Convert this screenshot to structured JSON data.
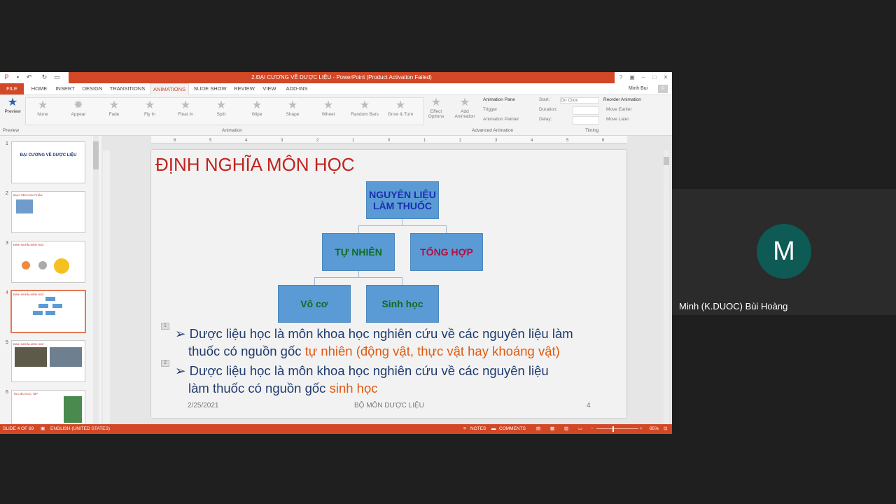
{
  "window": {
    "title": "2.ĐẠI CƯƠNG VỀ DƯỢC LIỆU - PowerPoint (Product Activation Failed)",
    "user": "Minh Bui",
    "accent": "#d24726"
  },
  "tabs": [
    "FILE",
    "HOME",
    "INSERT",
    "DESIGN",
    "TRANSITIONS",
    "ANIMATIONS",
    "SLIDE SHOW",
    "REVIEW",
    "VIEW",
    "ADD-INS"
  ],
  "ribbon": {
    "preview_label": "Preview",
    "preview_group": "Preview",
    "animations": [
      "None",
      "Appear",
      "Fade",
      "Fly In",
      "Float In",
      "Split",
      "Wipe",
      "Shape",
      "Wheel",
      "Random Bars",
      "Grow & Turn"
    ],
    "animation_group": "Animation",
    "effect_options": "Effect Options",
    "add_animation": "Add Animation",
    "animation_pane": "Animation Pane",
    "trigger": "Trigger",
    "animation_painter": "Animation Painter",
    "advanced_group": "Advanced Animation",
    "start_label": "Start:",
    "start_value": "On Click",
    "duration_label": "Duration:",
    "delay_label": "Delay:",
    "reorder": "Reorder Animation",
    "move_earlier": "Move Earlier",
    "move_later": "Move Later",
    "timing_group": "Timing"
  },
  "ruler_ticks": [
    "6",
    "5",
    "4",
    "3",
    "2",
    "1",
    "0",
    "1",
    "2",
    "3",
    "4",
    "5",
    "6"
  ],
  "thumbnails": [
    {
      "num": "1",
      "title": "ĐẠI CƯƠNG VỀ DƯỢC LIỆU"
    },
    {
      "num": "2",
      "title": "MỤC TIÊU HỌC PHẦN"
    },
    {
      "num": "3",
      "title": "ĐỊNH NGHĨA MÔN HỌC"
    },
    {
      "num": "4",
      "title": "ĐỊNH NGHĨA MÔN HỌC"
    },
    {
      "num": "5",
      "title": "ĐỊNH NGHĨA MÔN HỌC"
    },
    {
      "num": "6",
      "title": "TÀI LIỆU HỌC TẬP"
    }
  ],
  "slide": {
    "title": "ĐỊNH NGHĨA MÔN HỌC",
    "boxes": {
      "root": "NGUYÊN LIỆU LÀM THUỐC",
      "natural": "TỰ NHIÊN",
      "synthetic": "TỔNG HỢP",
      "inorganic": "Vô cơ",
      "biological": "Sinh học"
    },
    "bullet1_a": "Dược liệu học là môn khoa học nghiên cứu về các nguyên liệu làm",
    "bullet1_b": "thuốc có nguồn gốc ",
    "bullet1_hl": "tự nhiên (động vật, thực vật hay khoáng vật)",
    "bullet2_a": "Dược liệu học là môn khoa học nghiên cứu về các nguyên liệu",
    "bullet2_b": "làm thuốc có nguồn gốc ",
    "bullet2_hl": "sinh học",
    "anim_num1": "1",
    "anim_num2": "2",
    "date": "2/25/2021",
    "footer": "BỘ MÔN DƯỢC LIỆU",
    "page": "4"
  },
  "status": {
    "slide": "SLIDE 4 OF 69",
    "language": "ENGLISH (UNITED STATES)",
    "notes": "NOTES",
    "comments": "COMMENTS",
    "zoom": "85%"
  },
  "participant": {
    "initial": "M",
    "name": "Minh (K.DUOC) Bùi Hoàng",
    "avatar_color": "#0e5a55"
  }
}
